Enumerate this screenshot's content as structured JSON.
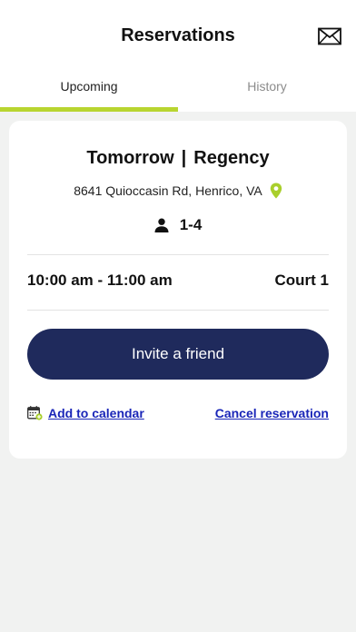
{
  "header": {
    "title": "Reservations",
    "mail_icon": "envelope-icon"
  },
  "tabs": [
    {
      "label": "Upcoming",
      "active": true
    },
    {
      "label": "History",
      "active": false
    }
  ],
  "colors": {
    "accent": "#b8d530",
    "primary_button": "#1f2a5c",
    "link": "#1a26b8",
    "background": "#f1f2f1"
  },
  "reservation": {
    "day": "Tomorrow",
    "separator": "|",
    "location": "Regency",
    "address": "8641 Quioccasin Rd, Henrico, VA",
    "address_icon": "map-pin-icon",
    "players_icon": "person-icon",
    "players": "1-4",
    "time": "10:00 am - 11:00 am",
    "court": "Court 1",
    "invite_label": "Invite a friend",
    "calendar_icon": "calendar-add-icon",
    "add_to_calendar_label": "Add to calendar",
    "cancel_label": "Cancel reservation"
  }
}
